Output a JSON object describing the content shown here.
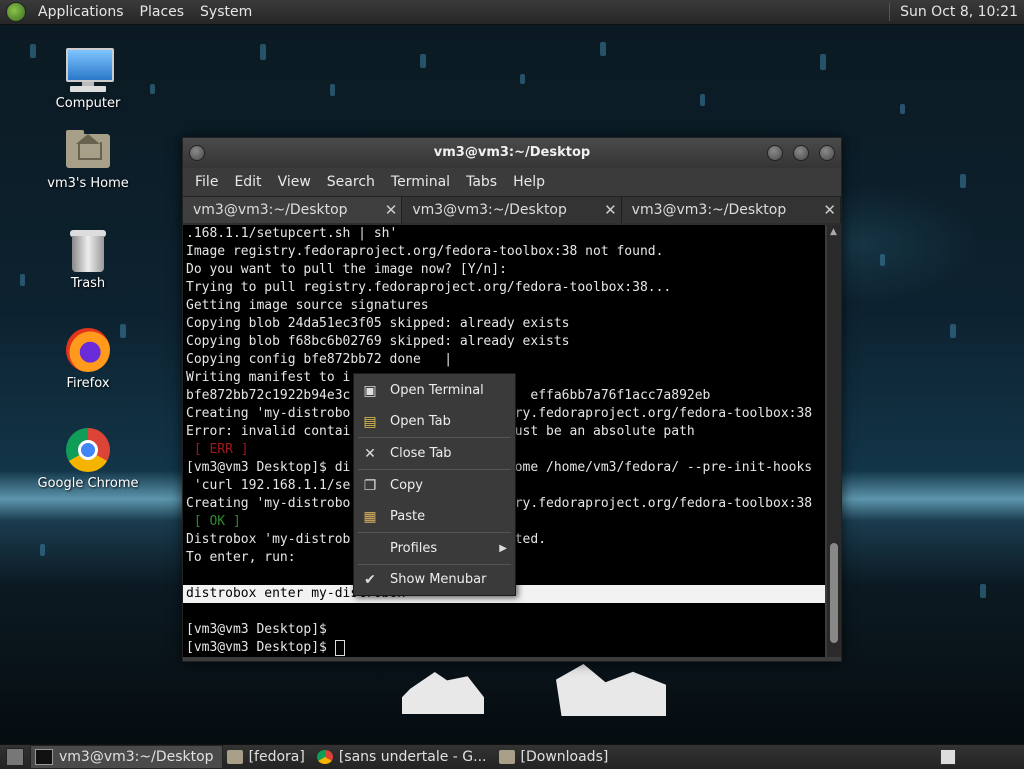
{
  "top_panel": {
    "menus": [
      "Applications",
      "Places",
      "System"
    ],
    "clock": "Sun Oct  8, 10:21"
  },
  "desktop_icons": [
    {
      "label": "Computer",
      "icon": "computer-icon"
    },
    {
      "label": "vm3's Home",
      "icon": "home-folder-icon"
    },
    {
      "label": "Trash",
      "icon": "trash-icon"
    },
    {
      "label": "Firefox",
      "icon": "firefox-icon"
    },
    {
      "label": "Google Chrome",
      "icon": "chrome-icon"
    }
  ],
  "window": {
    "title": "vm3@vm3:~/Desktop",
    "menubar": [
      "File",
      "Edit",
      "View",
      "Search",
      "Terminal",
      "Tabs",
      "Help"
    ],
    "tabs": [
      {
        "label": "vm3@vm3:~/Desktop",
        "active": true
      },
      {
        "label": "vm3@vm3:~/Desktop",
        "active": false
      },
      {
        "label": "vm3@vm3:~/Desktop",
        "active": false
      }
    ],
    "close_glyph": "✕"
  },
  "terminal": {
    "lines": [
      ".168.1.1/setupcert.sh | sh'",
      "Image registry.fedoraproject.org/fedora-toolbox:38 not found.",
      "Do you want to pull the image now? [Y/n]:",
      "Trying to pull registry.fedoraproject.org/fedora-toolbox:38...",
      "Getting image source signatures",
      "Copying blob 24da51ec3f05 skipped: already exists",
      "Copying blob f68bc6b02769 skipped: already exists",
      "Copying config bfe872bb72 done   |",
      "Writing manifest to i",
      "bfe872bb72c1922b94e3c                       effa6bb7a76f1acc7a892eb",
      "Creating 'my-distrobo                    try.fedoraproject.org/fedora-toolbox:38",
      "Error: invalid contai                    must be an absolute path",
      " [ ERR ]",
      "[vm3@vm3 Desktop]$ di                    home /home/vm3/fedora/ --pre-init-hooks",
      " 'curl 192.168.1.1/se",
      "Creating 'my-distrobo                    try.fedoraproject.org/fedora-toolbox:38",
      " [ OK ]",
      "Distrobox 'my-distrob                    ated.",
      "To enter, run:",
      "",
      "distrobox enter my-distrobox",
      "",
      "[vm3@vm3 Desktop]$",
      "[vm3@vm3 Desktop]$ "
    ]
  },
  "context_menu": {
    "items": [
      {
        "label": "Open Terminal",
        "icon": "terminal-icon"
      },
      {
        "label": "Open Tab",
        "icon": "new-tab-icon"
      },
      {
        "label": "Close Tab",
        "icon": "close-icon",
        "glyph": "✕"
      },
      {
        "label": "Copy",
        "icon": "copy-icon"
      },
      {
        "label": "Paste",
        "icon": "paste-icon"
      },
      {
        "label": "Profiles",
        "icon": "",
        "submenu": true
      },
      {
        "label": "Show Menubar",
        "icon": "check-icon",
        "glyph": "✔"
      }
    ],
    "submenu_glyph": "▶"
  },
  "bottom_panel": {
    "tasks": [
      {
        "label": "vm3@vm3:~/Desktop",
        "icon": "terminal-icon",
        "active": true
      },
      {
        "label": "[fedora]",
        "icon": "folder-icon",
        "active": false
      },
      {
        "label": "[sans undertale - G...",
        "icon": "chrome-icon",
        "active": false
      },
      {
        "label": "[Downloads]",
        "icon": "folder-icon",
        "active": false
      }
    ]
  },
  "colors": {
    "terminal_bg": "#000000",
    "err_red": "#a01818",
    "ok_green": "#2e8b2e",
    "highlight": "#f2f2f2"
  }
}
